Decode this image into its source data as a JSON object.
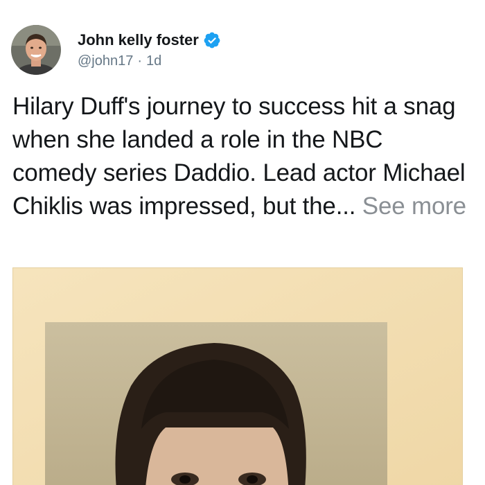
{
  "post": {
    "author": {
      "display_name": "John kelly foster",
      "handle": "@john17",
      "separator": "·",
      "time": "1d",
      "verified_icon": "verified-badge-icon",
      "avatar_icon": "avatar-photo"
    },
    "text": "Hilary Duff's journey to success hit a snag when she landed a role in the NBC comedy series Daddio. Lead actor Michael Chiklis was impressed, but the...",
    "see_more": "See more",
    "media": {
      "type": "photo",
      "icon": "vintage-portrait-photo"
    },
    "colors": {
      "verified": "#1da1f2",
      "name": "#14171a",
      "meta": "#657786",
      "see_more": "#8a8f94",
      "photo_paper": "#f3dfb5"
    }
  }
}
